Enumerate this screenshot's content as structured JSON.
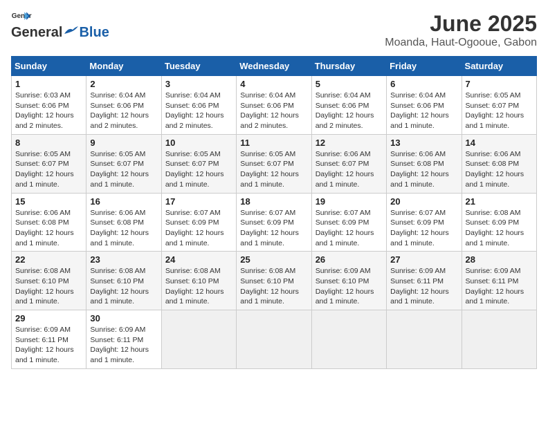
{
  "header": {
    "logo_general": "General",
    "logo_blue": "Blue",
    "month": "June 2025",
    "location": "Moanda, Haut-Ogooue, Gabon"
  },
  "columns": [
    "Sunday",
    "Monday",
    "Tuesday",
    "Wednesday",
    "Thursday",
    "Friday",
    "Saturday"
  ],
  "weeks": [
    [
      {
        "day": "1",
        "info": "Sunrise: 6:03 AM\nSunset: 6:06 PM\nDaylight: 12 hours\nand 2 minutes."
      },
      {
        "day": "2",
        "info": "Sunrise: 6:04 AM\nSunset: 6:06 PM\nDaylight: 12 hours\nand 2 minutes."
      },
      {
        "day": "3",
        "info": "Sunrise: 6:04 AM\nSunset: 6:06 PM\nDaylight: 12 hours\nand 2 minutes."
      },
      {
        "day": "4",
        "info": "Sunrise: 6:04 AM\nSunset: 6:06 PM\nDaylight: 12 hours\nand 2 minutes."
      },
      {
        "day": "5",
        "info": "Sunrise: 6:04 AM\nSunset: 6:06 PM\nDaylight: 12 hours\nand 2 minutes."
      },
      {
        "day": "6",
        "info": "Sunrise: 6:04 AM\nSunset: 6:06 PM\nDaylight: 12 hours\nand 1 minute."
      },
      {
        "day": "7",
        "info": "Sunrise: 6:05 AM\nSunset: 6:07 PM\nDaylight: 12 hours\nand 1 minute."
      }
    ],
    [
      {
        "day": "8",
        "info": "Sunrise: 6:05 AM\nSunset: 6:07 PM\nDaylight: 12 hours\nand 1 minute."
      },
      {
        "day": "9",
        "info": "Sunrise: 6:05 AM\nSunset: 6:07 PM\nDaylight: 12 hours\nand 1 minute."
      },
      {
        "day": "10",
        "info": "Sunrise: 6:05 AM\nSunset: 6:07 PM\nDaylight: 12 hours\nand 1 minute."
      },
      {
        "day": "11",
        "info": "Sunrise: 6:05 AM\nSunset: 6:07 PM\nDaylight: 12 hours\nand 1 minute."
      },
      {
        "day": "12",
        "info": "Sunrise: 6:06 AM\nSunset: 6:07 PM\nDaylight: 12 hours\nand 1 minute."
      },
      {
        "day": "13",
        "info": "Sunrise: 6:06 AM\nSunset: 6:08 PM\nDaylight: 12 hours\nand 1 minute."
      },
      {
        "day": "14",
        "info": "Sunrise: 6:06 AM\nSunset: 6:08 PM\nDaylight: 12 hours\nand 1 minute."
      }
    ],
    [
      {
        "day": "15",
        "info": "Sunrise: 6:06 AM\nSunset: 6:08 PM\nDaylight: 12 hours\nand 1 minute."
      },
      {
        "day": "16",
        "info": "Sunrise: 6:06 AM\nSunset: 6:08 PM\nDaylight: 12 hours\nand 1 minute."
      },
      {
        "day": "17",
        "info": "Sunrise: 6:07 AM\nSunset: 6:09 PM\nDaylight: 12 hours\nand 1 minute."
      },
      {
        "day": "18",
        "info": "Sunrise: 6:07 AM\nSunset: 6:09 PM\nDaylight: 12 hours\nand 1 minute."
      },
      {
        "day": "19",
        "info": "Sunrise: 6:07 AM\nSunset: 6:09 PM\nDaylight: 12 hours\nand 1 minute."
      },
      {
        "day": "20",
        "info": "Sunrise: 6:07 AM\nSunset: 6:09 PM\nDaylight: 12 hours\nand 1 minute."
      },
      {
        "day": "21",
        "info": "Sunrise: 6:08 AM\nSunset: 6:09 PM\nDaylight: 12 hours\nand 1 minute."
      }
    ],
    [
      {
        "day": "22",
        "info": "Sunrise: 6:08 AM\nSunset: 6:10 PM\nDaylight: 12 hours\nand 1 minute."
      },
      {
        "day": "23",
        "info": "Sunrise: 6:08 AM\nSunset: 6:10 PM\nDaylight: 12 hours\nand 1 minute."
      },
      {
        "day": "24",
        "info": "Sunrise: 6:08 AM\nSunset: 6:10 PM\nDaylight: 12 hours\nand 1 minute."
      },
      {
        "day": "25",
        "info": "Sunrise: 6:08 AM\nSunset: 6:10 PM\nDaylight: 12 hours\nand 1 minute."
      },
      {
        "day": "26",
        "info": "Sunrise: 6:09 AM\nSunset: 6:10 PM\nDaylight: 12 hours\nand 1 minute."
      },
      {
        "day": "27",
        "info": "Sunrise: 6:09 AM\nSunset: 6:11 PM\nDaylight: 12 hours\nand 1 minute."
      },
      {
        "day": "28",
        "info": "Sunrise: 6:09 AM\nSunset: 6:11 PM\nDaylight: 12 hours\nand 1 minute."
      }
    ],
    [
      {
        "day": "29",
        "info": "Sunrise: 6:09 AM\nSunset: 6:11 PM\nDaylight: 12 hours\nand 1 minute."
      },
      {
        "day": "30",
        "info": "Sunrise: 6:09 AM\nSunset: 6:11 PM\nDaylight: 12 hours\nand 1 minute."
      },
      {
        "day": "",
        "info": ""
      },
      {
        "day": "",
        "info": ""
      },
      {
        "day": "",
        "info": ""
      },
      {
        "day": "",
        "info": ""
      },
      {
        "day": "",
        "info": ""
      }
    ]
  ]
}
